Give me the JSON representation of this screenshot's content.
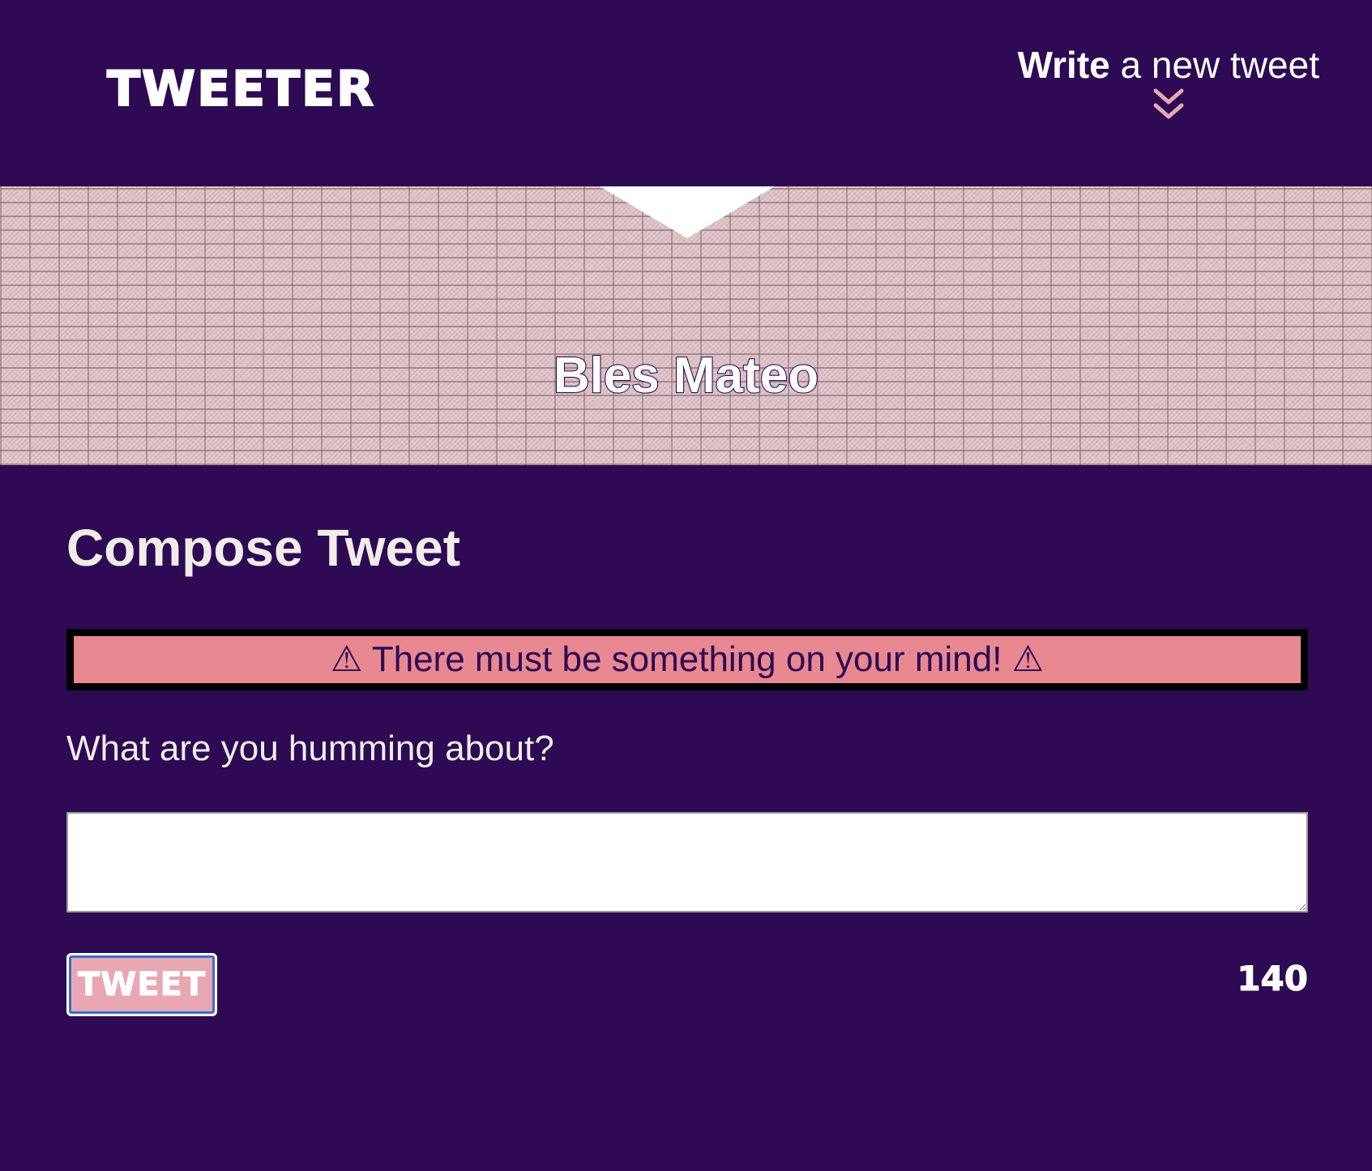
{
  "nav": {
    "brand": "TWEETER",
    "write_strong": "Write",
    "write_rest": " a new tweet",
    "chevron_icon": "double-chevron-down-icon"
  },
  "profile": {
    "name": "Bles Mateo"
  },
  "compose": {
    "title": "Compose Tweet",
    "error_message": "⚠ There must be something on your mind! ⚠",
    "prompt": "What are you humming about?",
    "textarea_value": "",
    "button_label": "TWEET",
    "counter": "140"
  },
  "colors": {
    "background": "#2d0a53",
    "error_bg": "#e88891",
    "button_bg": "#e8a7b3",
    "chevron": "#e8a7b3"
  }
}
